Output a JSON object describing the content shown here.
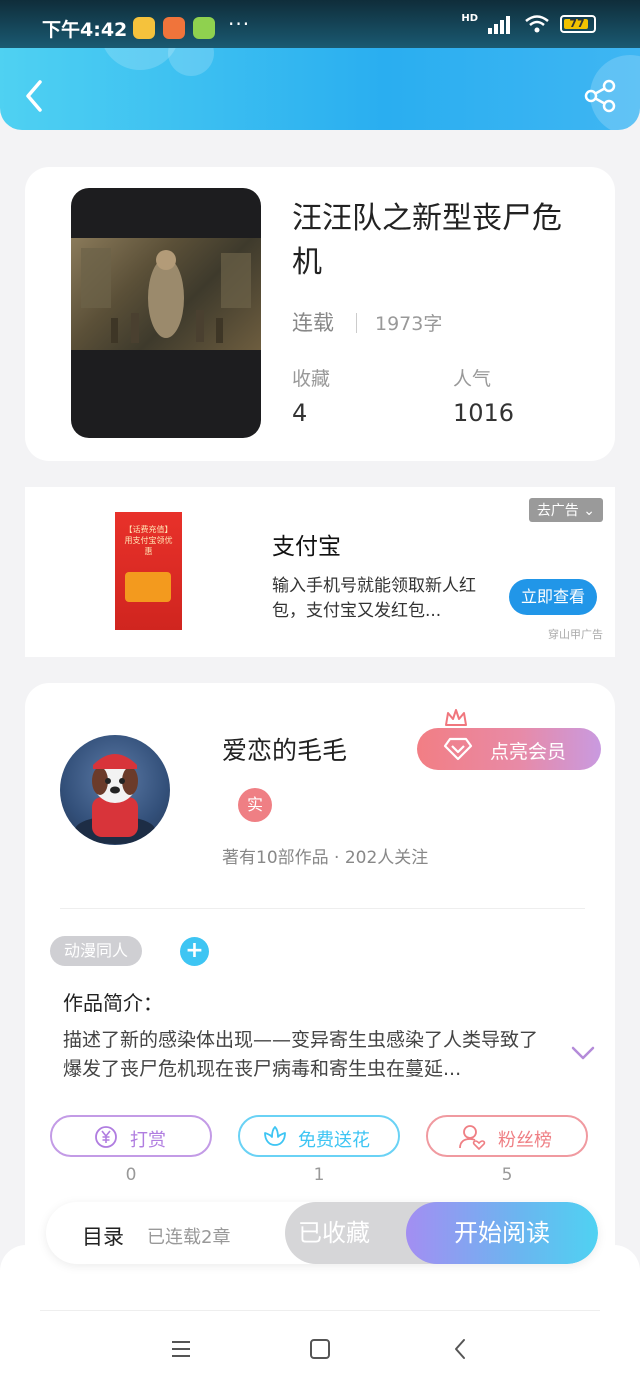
{
  "status_bar": {
    "time": "下午4:42",
    "dots": "···",
    "network": "HD",
    "battery": "77"
  },
  "book": {
    "title": "汪汪队之新型丧尸危机",
    "status": "连载",
    "word_count": "1973字",
    "favorites_label": "收藏",
    "favorites_value": "4",
    "popularity_label": "人气",
    "popularity_value": "1016"
  },
  "ad": {
    "close_label": "去广告",
    "title": "支付宝",
    "description": "输入手机号就能领取新人红包，支付宝又发红包...",
    "cta": "立即查看",
    "source": "穿山甲广告",
    "image_text": "【话费充值】用支付宝领优惠"
  },
  "author": {
    "name": "爱恋的毛毛",
    "badge": "实",
    "meta": "著有10部作品 · 202人关注",
    "vip_button": "点亮会员"
  },
  "intro": {
    "tag": "动漫同人",
    "tag_add": "+",
    "label": "作品简介：",
    "text": "描述了新的感染体出现——变异寄生虫感染了人类导致了爆发了丧尸危机现在丧尸病毒和寄生虫在蔓延..."
  },
  "actions": [
    {
      "label": "打赏",
      "count": "0",
      "color": "#b07de0"
    },
    {
      "label": "免费送花",
      "count": "1",
      "color": "#3ec5f3"
    },
    {
      "label": "粉丝榜",
      "count": "5",
      "color": "#ef7f84"
    }
  ],
  "bottom_bar": {
    "toc": "目录",
    "toc_sub": "已连载2章",
    "favorited": "已收藏",
    "start_reading": "开始阅读"
  },
  "colors": {
    "header_accent": "#2aaef0",
    "reward": "#b07de0",
    "flower": "#3ec5f3",
    "fans": "#ef7f84"
  }
}
